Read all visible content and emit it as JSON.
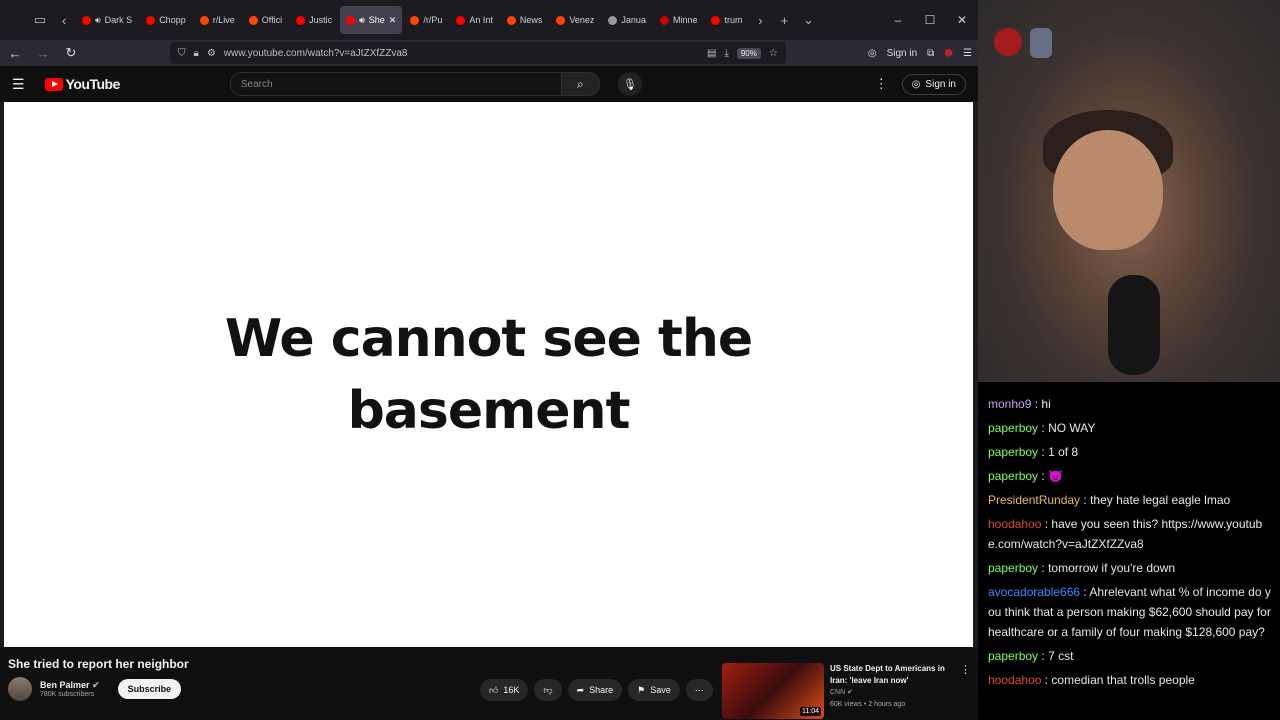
{
  "browser": {
    "tabs": [
      {
        "title": "Dark S",
        "favicon_color": "#ff0000",
        "audio": true
      },
      {
        "title": "Chopp",
        "favicon_color": "#ff0000"
      },
      {
        "title": "r/Live",
        "favicon_color": "#ff4500"
      },
      {
        "title": "Offici",
        "favicon_color": "#ff4500"
      },
      {
        "title": "Justic",
        "favicon_color": "#ff0000"
      },
      {
        "title": "She",
        "favicon_color": "#ff0000",
        "audio": true,
        "active": true
      },
      {
        "title": "/r/Pu",
        "favicon_color": "#ff4500"
      },
      {
        "title": "An Int",
        "favicon_color": "#ff0000"
      },
      {
        "title": "News",
        "favicon_color": "#ff4500"
      },
      {
        "title": "Venez",
        "favicon_color": "#ff4500"
      },
      {
        "title": "Janua",
        "favicon_color": "#999999"
      },
      {
        "title": "Minne",
        "favicon_color": "#cc0000"
      },
      {
        "title": "trum",
        "favicon_color": "#ff0000"
      }
    ],
    "url": "www.youtube.com/watch?v=aJtZXfZZva8",
    "zoom": "90%",
    "signin_label": "Sign in"
  },
  "youtube": {
    "logo_text": "YouTube",
    "search_placeholder": "Search",
    "signin_label": "Sign in",
    "player_text": [
      "We cannot see the",
      "basement"
    ],
    "video_title": "She tried to report her neighbor",
    "channel_name": "Ben Palmer",
    "subscribers": "780K subscribers",
    "subscribe_label": "Subscribe",
    "likes": "16K",
    "share_label": "Share",
    "save_label": "Save",
    "recommended": {
      "title": "US State Dept to Americans in Iran: 'leave Iran now'",
      "channel": "CNN",
      "meta": "60K views • 2 hours ago",
      "duration": "11:04"
    }
  },
  "chat": [
    {
      "user": "monho9",
      "color": "#c8a0f0",
      "text": "hi"
    },
    {
      "user": "paperboy",
      "color": "#7cff5a",
      "text": "NO WAY"
    },
    {
      "user": "paperboy",
      "color": "#7cff5a",
      "text": "1 of 8"
    },
    {
      "user": "paperboy",
      "color": "#7cff5a",
      "text": "👿"
    },
    {
      "user": "PresidentRunday",
      "color": "#e8b860",
      "text": "they hate legal eagle lmao"
    },
    {
      "user": "hoodahoo",
      "color": "#e0483a",
      "text": "have you seen this? https://www.youtube.com/watch?v=aJtZXfZZva8"
    },
    {
      "user": "paperboy",
      "color": "#7cff5a",
      "text": "tomorrow if you're down"
    },
    {
      "user": "avocadorable666",
      "color": "#3a8cff",
      "text": "Ahrelevant what % of income do you think that a person making $62,600 should pay for healthcare or a family of four making $128,600 pay?"
    },
    {
      "user": "paperboy",
      "color": "#7cff5a",
      "text": "7 cst"
    },
    {
      "user": "hoodahoo",
      "color": "#e0483a",
      "text": "comedian that trolls people"
    }
  ]
}
